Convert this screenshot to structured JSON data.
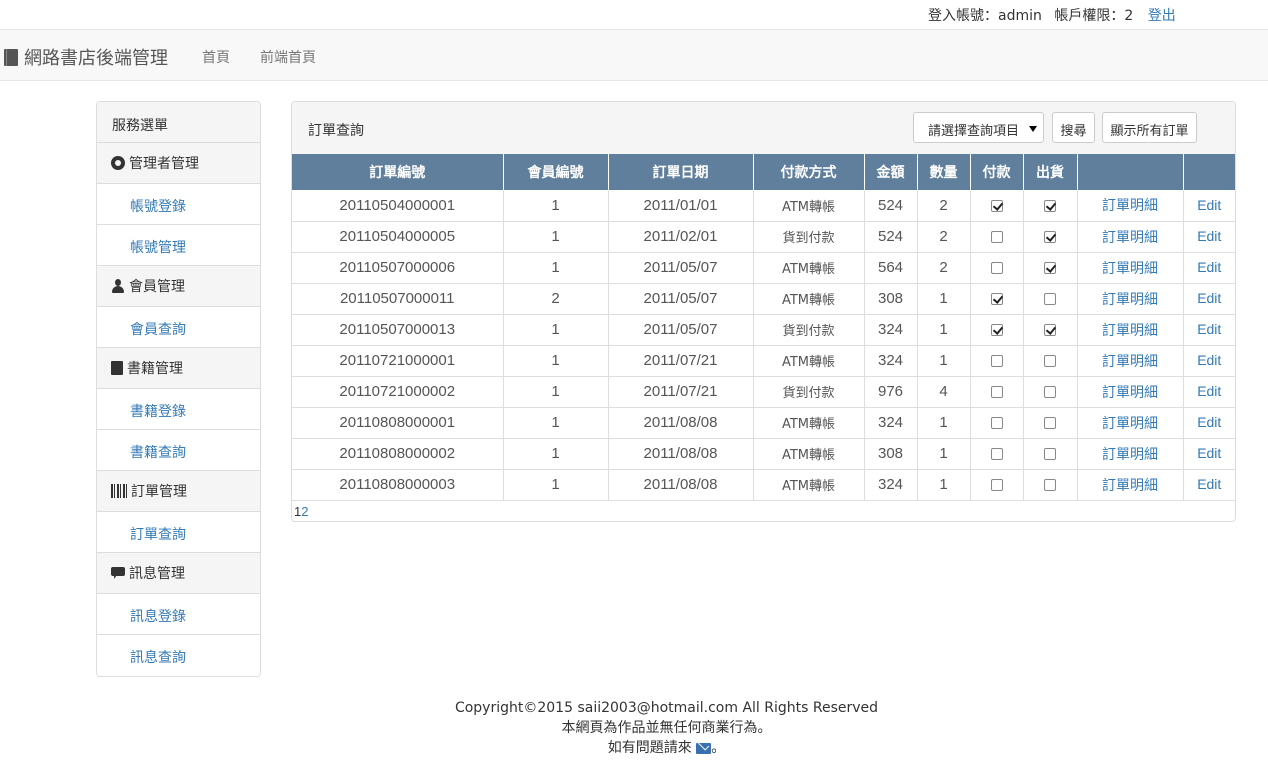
{
  "topbar": {
    "account_label": "登入帳號：admin",
    "permission_label": "帳戶權限：2",
    "logout": "登出"
  },
  "navbar": {
    "brand": "網路書店後端管理",
    "links": [
      "首頁",
      "前端首頁"
    ]
  },
  "sidebar": {
    "title": "服務選單",
    "groups": [
      {
        "label": "管理者管理",
        "icon": "gear-icon",
        "items": [
          "帳號登錄",
          "帳號管理"
        ]
      },
      {
        "label": "會員管理",
        "icon": "user-icon",
        "items": [
          "會員查詢"
        ]
      },
      {
        "label": "書籍管理",
        "icon": "book-icon",
        "items": [
          "書籍登錄",
          "書籍查詢"
        ]
      },
      {
        "label": "訂單管理",
        "icon": "barcode-icon",
        "items": [
          "訂單查詢"
        ]
      },
      {
        "label": "訊息管理",
        "icon": "comment-icon",
        "items": [
          "訊息登錄",
          "訊息查詢"
        ]
      }
    ]
  },
  "panel": {
    "title": "訂單查詢",
    "select_value": "請選擇查詢項目",
    "search_button": "搜尋",
    "show_all_button": "顯示所有訂單"
  },
  "table": {
    "headers": [
      "訂單編號",
      "會員編號",
      "訂單日期",
      "付款方式",
      "金額",
      "數量",
      "付款",
      "出貨",
      "",
      ""
    ],
    "rows": [
      {
        "id": "20110504000001",
        "member": "1",
        "date": "2011/01/01",
        "pay": "ATM轉帳",
        "amount": "524",
        "qty": "2",
        "paid": true,
        "shipped": true,
        "detail": "訂單明細",
        "edit": "Edit"
      },
      {
        "id": "20110504000005",
        "member": "1",
        "date": "2011/02/01",
        "pay": "貨到付款",
        "amount": "524",
        "qty": "2",
        "paid": false,
        "shipped": true,
        "detail": "訂單明細",
        "edit": "Edit"
      },
      {
        "id": "20110507000006",
        "member": "1",
        "date": "2011/05/07",
        "pay": "ATM轉帳",
        "amount": "564",
        "qty": "2",
        "paid": false,
        "shipped": true,
        "detail": "訂單明細",
        "edit": "Edit"
      },
      {
        "id": "20110507000011",
        "member": "2",
        "date": "2011/05/07",
        "pay": "ATM轉帳",
        "amount": "308",
        "qty": "1",
        "paid": true,
        "shipped": false,
        "detail": "訂單明細",
        "edit": "Edit"
      },
      {
        "id": "20110507000013",
        "member": "1",
        "date": "2011/05/07",
        "pay": "貨到付款",
        "amount": "324",
        "qty": "1",
        "paid": true,
        "shipped": true,
        "detail": "訂單明細",
        "edit": "Edit"
      },
      {
        "id": "20110721000001",
        "member": "1",
        "date": "2011/07/21",
        "pay": "ATM轉帳",
        "amount": "324",
        "qty": "1",
        "paid": false,
        "shipped": false,
        "detail": "訂單明細",
        "edit": "Edit"
      },
      {
        "id": "20110721000002",
        "member": "1",
        "date": "2011/07/21",
        "pay": "貨到付款",
        "amount": "976",
        "qty": "4",
        "paid": false,
        "shipped": false,
        "detail": "訂單明細",
        "edit": "Edit"
      },
      {
        "id": "20110808000001",
        "member": "1",
        "date": "2011/08/08",
        "pay": "ATM轉帳",
        "amount": "324",
        "qty": "1",
        "paid": false,
        "shipped": false,
        "detail": "訂單明細",
        "edit": "Edit"
      },
      {
        "id": "20110808000002",
        "member": "1",
        "date": "2011/08/08",
        "pay": "ATM轉帳",
        "amount": "308",
        "qty": "1",
        "paid": false,
        "shipped": false,
        "detail": "訂單明細",
        "edit": "Edit"
      },
      {
        "id": "20110808000003",
        "member": "1",
        "date": "2011/08/08",
        "pay": "ATM轉帳",
        "amount": "324",
        "qty": "1",
        "paid": false,
        "shipped": false,
        "detail": "訂單明細",
        "edit": "Edit"
      }
    ]
  },
  "pager": {
    "current": "1",
    "pages": [
      "2"
    ]
  },
  "footer": {
    "copyright": "Copyright©2015 saii2003@hotmail.com All Rights Reserved",
    "line2": "本網頁為作品並無任何商業行為。",
    "line3_prefix": "如有問題請來",
    "line3_suffix": "。"
  },
  "colors": {
    "header_bg": "#5f7f9c",
    "link": "#337ab7"
  }
}
